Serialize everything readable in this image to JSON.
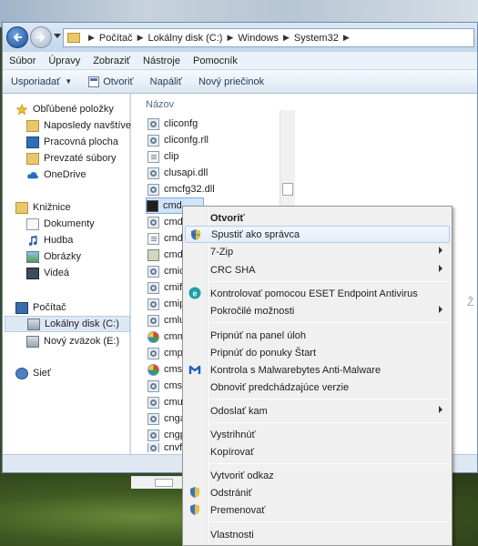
{
  "address": {
    "crumbs": [
      "Počítač",
      "Lokálny disk (C:)",
      "Windows",
      "System32"
    ]
  },
  "menubar": [
    "Súbor",
    "Úpravy",
    "Zobraziť",
    "Nástroje",
    "Pomocník"
  ],
  "toolbar": {
    "organize": "Usporiadať",
    "open": "Otvoriť",
    "burn": "Napáliť",
    "new_folder": "Nový priečinok"
  },
  "navpane": {
    "favorites": {
      "header": "Obľúbené položky",
      "items": [
        "Naposledy navštíver",
        "Pracovná plocha",
        "Prevzaté súbory",
        "OneDrive"
      ]
    },
    "libraries": {
      "header": "Knižnice",
      "items": [
        "Dokumenty",
        "Hudba",
        "Obrázky",
        "Videá"
      ]
    },
    "computer": {
      "header": "Počítač",
      "items": [
        "Lokálny disk (C:)",
        "Nový zväzok (E:)"
      ]
    },
    "network": "Sieť"
  },
  "files": {
    "column": "Názov",
    "items": [
      "cliconfg",
      "cliconfg.rll",
      "clip",
      "clusapi.dll",
      "cmcfg32.dll",
      "cmd",
      "cmdi",
      "cmdl",
      "cmdl",
      "cmic",
      "cmif",
      "cmip",
      "cmlu",
      "cmm",
      "cmpl",
      "cmst",
      "cmst",
      "cmut",
      "cnga",
      "cngp",
      "cnvfa"
    ]
  },
  "right_letter": "Ž",
  "context_menu": {
    "open": "Otvoriť",
    "run_as_admin": "Spustiť ako správca",
    "sevenzip": "7-Zip",
    "crcsha": "CRC SHA",
    "eset": "Kontrolovať pomocou ESET Endpoint Antivirus",
    "advanced": "Pokročilé možnosti",
    "pin_taskbar": "Pripnúť na panel úloh",
    "pin_start": "Pripnúť do ponuky Štart",
    "malwarebytes": "Kontrola s Malwarebytes Anti-Malware",
    "restore": "Obnoviť predchádzajúce verzie",
    "send_to": "Odoslať kam",
    "cut": "Vystrihnúť",
    "copy": "Kopírovať",
    "shortcut": "Vytvoriť odkaz",
    "delete": "Odstrániť",
    "rename": "Premenovať",
    "properties": "Vlastnosti"
  }
}
